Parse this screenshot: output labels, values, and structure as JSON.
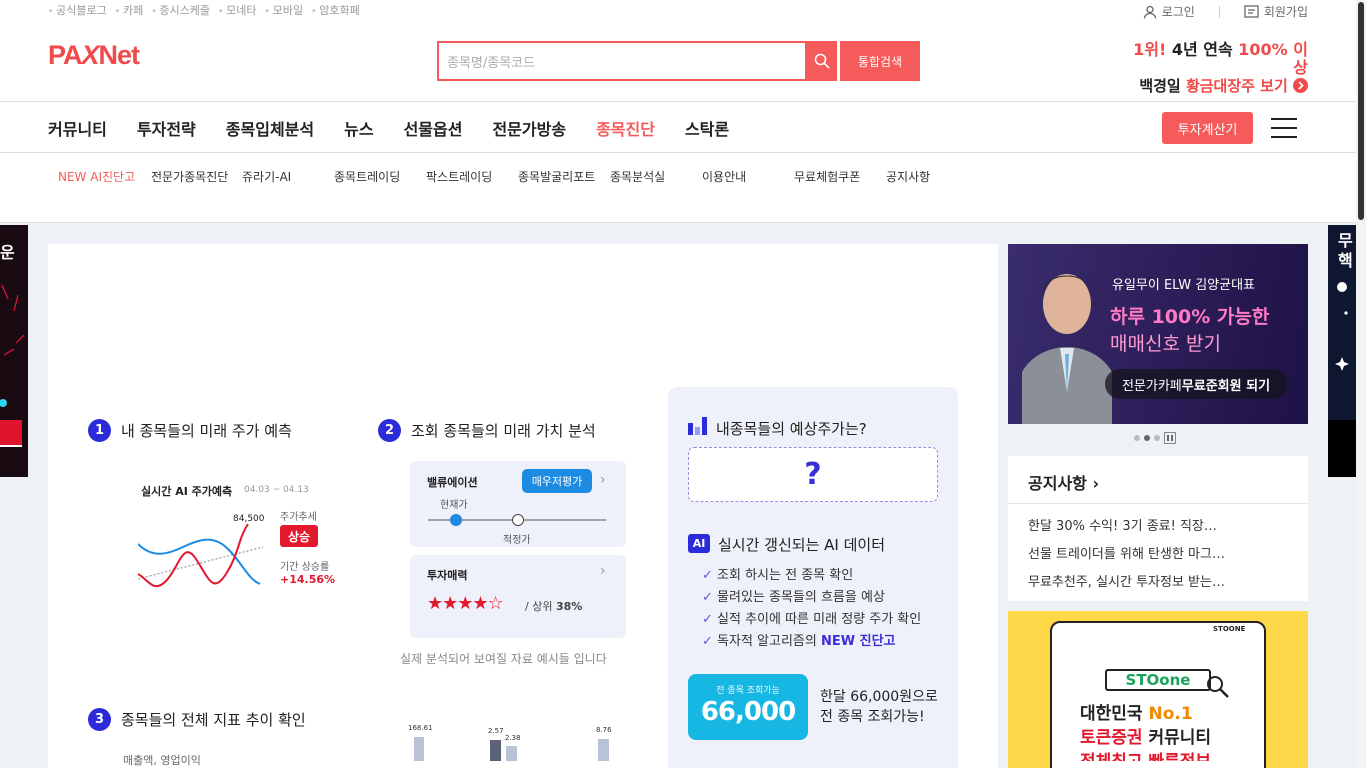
{
  "util": {
    "links": [
      "공식블로그",
      "카페",
      "증시스케줄",
      "모네타",
      "모바일",
      "암호화폐"
    ],
    "login": "로그인",
    "join": "회원가입"
  },
  "header": {
    "logo_pa": "PA",
    "logo_x": "X",
    "logo_net": "Net",
    "search_placeholder": "종목명/종목코드",
    "search_button": "통합검색",
    "ad_line1_a": "1위!",
    "ad_line1_b": " 4년 연속 ",
    "ad_line1_c": "100% 이상",
    "ad_line2_a": "백경일 ",
    "ad_line2_b": "황금대장주 보기"
  },
  "gnb": {
    "items": [
      "커뮤니티",
      "투자전략",
      "종목입체분석",
      "뉴스",
      "선물옵션",
      "전문가방송",
      "종목진단",
      "스탁론"
    ],
    "active_index": 6,
    "calc_button": "투자계산기"
  },
  "subnav": {
    "items": [
      "NEW AI진단고",
      "전문가종목진단",
      "쥬라기-AI",
      "종목트레이딩",
      "팍스트레이딩",
      "종목발굴리포트",
      "종목분석실",
      "이용안내",
      "무료체험쿠폰",
      "공지사항"
    ]
  },
  "main": {
    "sec1": {
      "num": "1",
      "title": "내 종목들의 미래 주가 예측"
    },
    "sec2": {
      "num": "2",
      "title": "조회 종목들의 미래 가치 분석"
    },
    "sec3": {
      "num": "3",
      "title": "종목들의 전체 지표 추이 확인"
    },
    "ai_chart": {
      "title": "실시간 AI 주가예측",
      "period": "04.03 ~ 04.13",
      "price": "84,500",
      "trend_label": "주가추세",
      "trend_value": "상승",
      "rate_label": "기간 상승률",
      "rate_value": "+14.56%"
    },
    "valuation": {
      "title": "밸류에이션",
      "badge": "매우저평가",
      "current": "현재가",
      "fair": "적정가"
    },
    "attract": {
      "title": "투자매력",
      "stars": "★★★★☆",
      "rank_prefix": "/ 상위 ",
      "rank_value": "38%"
    },
    "example_note": "실제 분석되어 보여질 자료 예시들 입니다",
    "bars": {
      "labels": [
        "168.61",
        "2.57",
        "2.38",
        "8.76"
      ]
    },
    "cut_text": "매출액, 영업이익"
  },
  "panel": {
    "title": "내종목들의 예상주가는?",
    "question": "?",
    "ai_badge": "AI",
    "ai_title": "실시간 갱신되는 AI 데이터",
    "checks": [
      "조회 하시는 전 종목 확인",
      "물려있는 종목들의 흐름을 예상",
      "실적 추이에 따른 미래 정량 주가 확인"
    ],
    "check4_prefix": "독자적 알고리즘의 ",
    "check4_highlight": "NEW 진단고",
    "price_small": "전 종목 조회가능",
    "price_big": "66,000",
    "price_desc1": "한달 66,000원으로",
    "price_desc2": "전 종목 조회가능!"
  },
  "banner": {
    "line1": "유일무이 ELW 김양균대표",
    "line2": "하루 100% 가능한",
    "line3": "매매신호 받기",
    "cta_a": "전문가카페 ",
    "cta_b": "무료준회원 되기"
  },
  "notice": {
    "title": "공지사항",
    "items": [
      "한달 30% 수익! 3기 종료! 직장…",
      "선물 트레이더를 위해 탄생한 마그…",
      "무료추천주, 실시간 투자정보 받는…"
    ]
  },
  "yellow": {
    "brand_tag": "STOONE",
    "logo": "STOone",
    "line1_a": "대한민국 ",
    "line1_b": "No.1",
    "line2_a": "토큰증권",
    "line2_b": " 커뮤니티",
    "line3": "전체최고 빠른정보"
  },
  "side_left": {
    "text": "운"
  },
  "side_right": {
    "text1": "무",
    "text2": "핵"
  },
  "colors": {
    "accent": "#f55b5b",
    "brand": "#f04a4a",
    "navy": "#2b2bd9",
    "cyan": "#17b7e3"
  }
}
